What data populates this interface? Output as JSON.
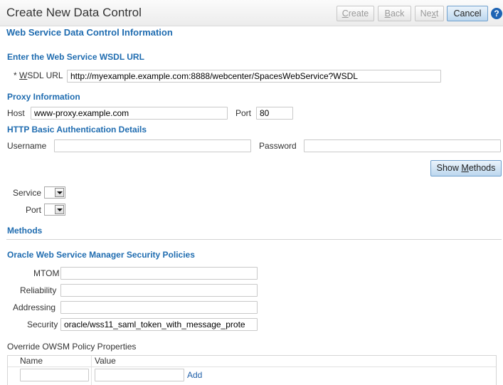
{
  "header": {
    "title": "Create New Data Control",
    "buttons": {
      "create": {
        "pre": "",
        "key": "C",
        "post": "reate"
      },
      "back": {
        "pre": "",
        "key": "B",
        "post": "ack"
      },
      "next": {
        "pre": "Ne",
        "key": "x",
        "post": "t"
      },
      "cancel": "Cancel"
    },
    "help_icon": "?"
  },
  "section_title": "Web Service Data Control Information",
  "wsdl": {
    "heading": "Enter the Web Service WSDL URL",
    "required_mark": "*",
    "label_key": "W",
    "label_rest": "SDL URL",
    "value": "http://myexample.example.com:8888/webcenter/SpacesWebService?WSDL"
  },
  "proxy": {
    "heading": "Proxy Information",
    "host_label": "Host",
    "host_value": "www-proxy.example.com",
    "port_label": "Port",
    "port_value": "80"
  },
  "auth": {
    "heading": "HTTP Basic Authentication Details",
    "username_label": "Username",
    "username_value": "",
    "password_label": "Password",
    "password_value": ""
  },
  "show_methods": {
    "pre": "Show ",
    "key": "M",
    "post": "ethods"
  },
  "service_label": "Service",
  "port_select_label": "Port",
  "methods_heading": "Methods",
  "owsm": {
    "heading": "Oracle Web Service Manager Security Policies",
    "mtom_label": "MTOM",
    "mtom_value": "",
    "reliability_label": "Reliability",
    "reliability_value": "",
    "addressing_label": "Addressing",
    "addressing_value": "",
    "security_label": "Security",
    "security_value": "oracle/wss11_saml_token_with_message_prote"
  },
  "override": {
    "title": "Override OWSM Policy Properties",
    "columns": [
      "Name",
      "Value"
    ],
    "name_value": "",
    "value_value": "",
    "add_link": "Add"
  },
  "icons": {
    "select_arrow": "chevron-down-icon",
    "help": "help-icon"
  },
  "colors": {
    "heading": "#1f6cb0",
    "primary_button": "#bcd7ee",
    "help_icon": "#1e64b4"
  }
}
